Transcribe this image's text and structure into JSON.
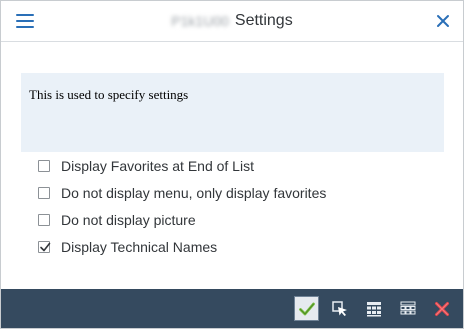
{
  "header": {
    "blurred_prefix": "P1k1U00",
    "title": "Settings"
  },
  "info": {
    "text": "This is used to specify settings"
  },
  "options": [
    {
      "label": "Display Favorites at End of List",
      "checked": false
    },
    {
      "label": "Do not display menu, only display favorites",
      "checked": false
    },
    {
      "label": "Do not display picture",
      "checked": false
    },
    {
      "label": "Display Technical Names",
      "checked": true
    }
  ],
  "footer": {
    "buttons": [
      "ok-check-icon",
      "select-cursor-icon",
      "grid-icon",
      "grid-alt-icon",
      "cancel-x-icon"
    ]
  },
  "colors": {
    "accent": "#2a6fb7",
    "footer_bg": "#354a5f",
    "info_bg": "#eaf1f8",
    "ok_green": "#7ac143",
    "cancel_red": "#e8474c"
  }
}
